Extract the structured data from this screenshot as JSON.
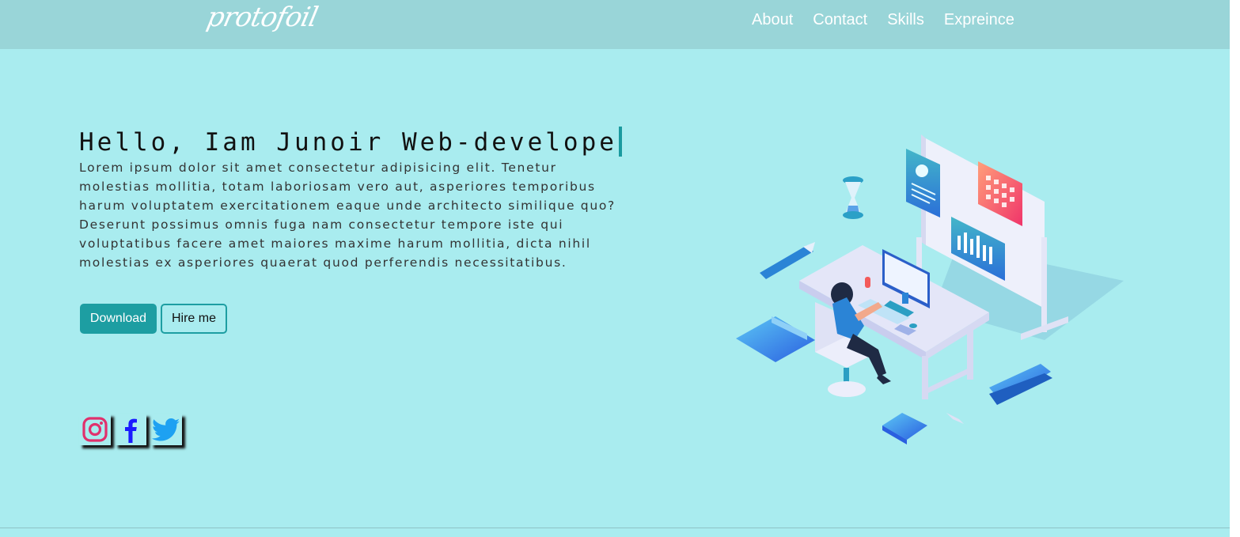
{
  "brand": {
    "logo": "protofoil"
  },
  "nav": {
    "links": [
      "About",
      "Contact",
      "Skills",
      "Expreince"
    ]
  },
  "hero": {
    "title": "Hello, Iam Junoir Web-develope",
    "description": "Lorem ipsum dolor sit amet consectetur adipisicing elit. Tenetur molestias mollitia, totam laboriosam vero aut, asperiores temporibus harum voluptatem exercitationem eaque unde architecto similique quo? Deserunt possimus omnis fuga nam consectetur tempore iste qui voluptatibus facere amet maiores maxime harum mollitia, dicta nihil molestias ex asperiores quaerat quod perferendis necessitatibus.",
    "download_label": "Download",
    "hire_label": "Hire me"
  },
  "socials": [
    "instagram-icon",
    "facebook-icon",
    "twitter-icon"
  ],
  "colors": {
    "background": "#a9ecef",
    "navbar": "#99d5d8",
    "accent": "#1d9ea2",
    "instagram": "#e1306c",
    "facebook": "#1a1aff",
    "twitter": "#1da1f2"
  }
}
